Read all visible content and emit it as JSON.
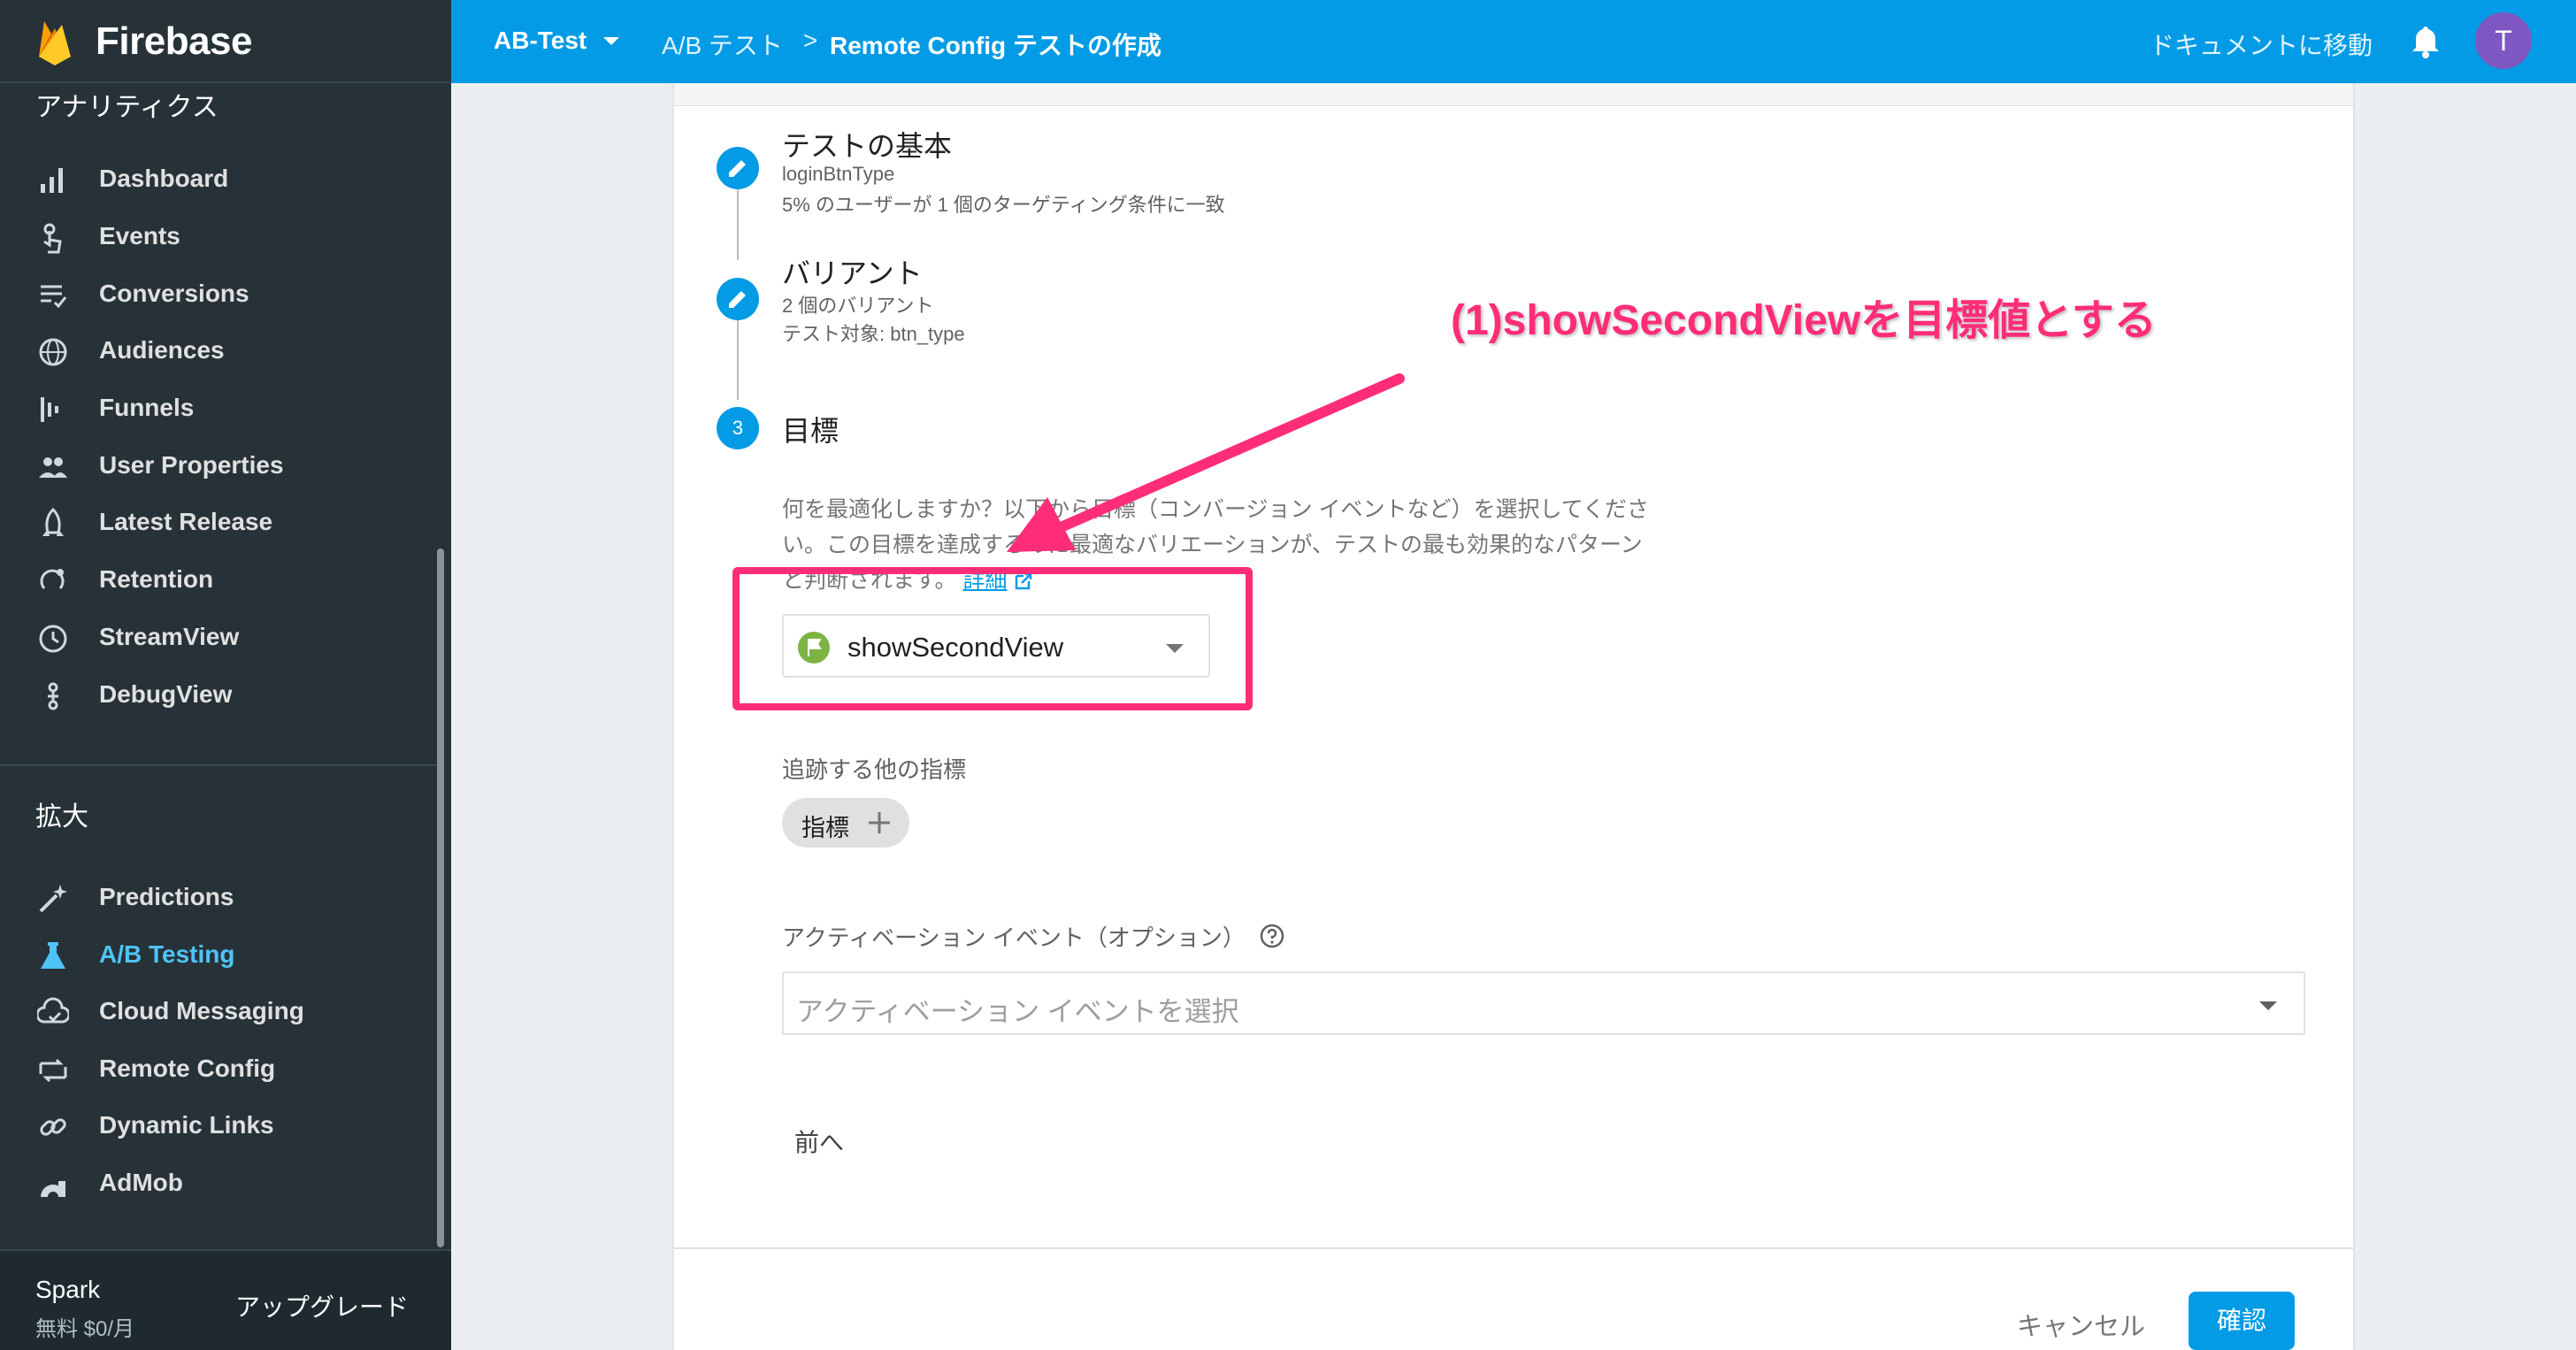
{
  "app": {
    "name": "Firebase"
  },
  "sidebar": {
    "section_analytics": "アナリティクス",
    "analytics_items": [
      {
        "label": "Dashboard",
        "icon": "bar-chart-icon"
      },
      {
        "label": "Events",
        "icon": "touch-icon"
      },
      {
        "label": "Conversions",
        "icon": "conversions-icon"
      },
      {
        "label": "Audiences",
        "icon": "globe-icon"
      },
      {
        "label": "Funnels",
        "icon": "funnel-icon"
      },
      {
        "label": "User Properties",
        "icon": "users-icon"
      },
      {
        "label": "Latest Release",
        "icon": "rocket-icon"
      },
      {
        "label": "Retention",
        "icon": "retention-icon"
      },
      {
        "label": "StreamView",
        "icon": "clock-icon"
      },
      {
        "label": "DebugView",
        "icon": "debug-icon"
      }
    ],
    "section_grow": "拡大",
    "grow_items": [
      {
        "label": "Predictions",
        "icon": "wand-icon"
      },
      {
        "label": "A/B Testing",
        "icon": "flask-icon",
        "active": true
      },
      {
        "label": "Cloud Messaging",
        "icon": "cloud-icon"
      },
      {
        "label": "Remote Config",
        "icon": "remote-config-icon"
      },
      {
        "label": "Dynamic Links",
        "icon": "link-icon"
      },
      {
        "label": "AdMob",
        "icon": "admob-icon"
      }
    ],
    "plan": {
      "name": "Spark",
      "price": "無料 $0/月",
      "upgrade": "アップグレード"
    }
  },
  "header": {
    "project": "AB-Test",
    "crumb1": "A/B テスト",
    "crumb_sep": ">",
    "crumb2": "Remote Config テストの作成",
    "docs": "ドキュメントに移動",
    "avatar": "T"
  },
  "steps": [
    {
      "title": "テストの基本",
      "sub1": "loginBtnType",
      "sub2": "5% のユーザーが 1 個のターゲティング条件に一致"
    },
    {
      "title": "バリアント",
      "sub1": "2 個のバリアント",
      "sub2": "テスト対象: btn_type"
    },
    {
      "number": "3",
      "title": "目標"
    }
  ],
  "goal": {
    "description_1": "何を最適化しますか？以下から目標（コンバージョン イベントなど）を選択してくださ",
    "description_2": "い。この目標を達成するのに最適なバリエーションが、テストの最も効果的なパターン",
    "description_3": "と判断されます。",
    "details_link": "詳細",
    "selected": "showSecondView",
    "other_metrics_label": "追跡する他の指標",
    "metric_chip": "指標",
    "activation_label": "アクティベーション イベント（オプション）",
    "activation_placeholder": "アクティベーション イベントを選択"
  },
  "actions": {
    "prev": "前へ",
    "cancel": "キャンセル",
    "confirm": "確認"
  },
  "annotation": {
    "text": "(1)showSecondViewを目標値とする",
    "color": "#ff2d78"
  },
  "colors": {
    "header": "#039be5",
    "sidebar": "#263238",
    "active": "#4fc3f7"
  }
}
